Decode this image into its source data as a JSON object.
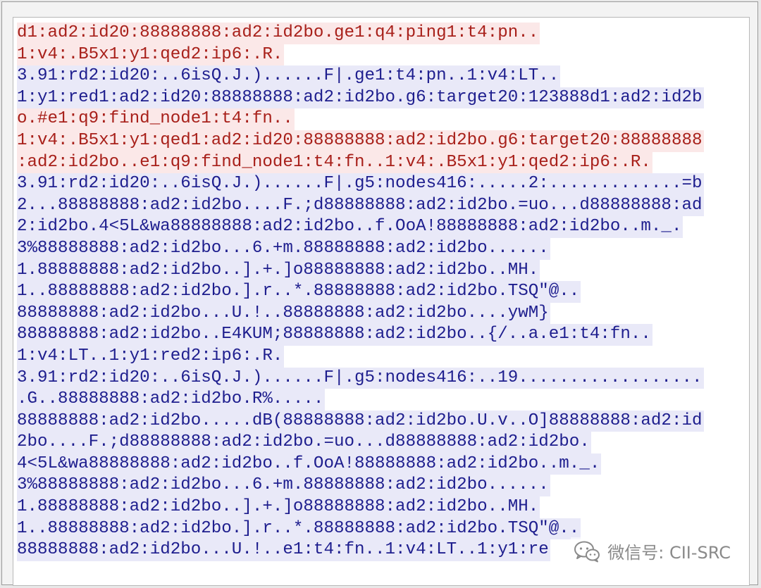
{
  "stream": {
    "lines": [
      {
        "dir": "client",
        "text": "d1:ad2:id20:88888888:ad2:id2bo.ge1:q4:ping1:t4:pn.."
      },
      {
        "dir": "client",
        "text": "1:v4:.B5x1:y1:qed2:ip6:.R."
      },
      {
        "dir": "server",
        "text": "3.91:rd2:id20:..6isQ.J.)......F|.ge1:t4:pn..1:v4:LT.."
      },
      {
        "dir": "server",
        "text": "1:y1:red1:ad2:id20:88888888:ad2:id2bo.g6:target20:123888d1:ad2:id2b"
      },
      {
        "dir": "client",
        "text": "o.#e1:q9:find_node1:t4:fn.."
      },
      {
        "dir": "client",
        "text": "1:v4:.B5x1:y1:qed1:ad2:id20:88888888:ad2:id2bo.g6:target20:88888888"
      },
      {
        "dir": "client",
        "text": ":ad2:id2bo..e1:q9:find_node1:t4:fn..1:v4:.B5x1:y1:qed2:ip6:.R."
      },
      {
        "dir": "server",
        "text": "3.91:rd2:id20:..6isQ.J.)......F|.g5:nodes416:.....2:.............=b"
      },
      {
        "dir": "server",
        "text": "2...88888888:ad2:id2bo....F.;d88888888:ad2:id2bo.=uo...d88888888:ad"
      },
      {
        "dir": "server",
        "text": "2:id2bo.4<5L&wa88888888:ad2:id2bo..f.OoA!88888888:ad2:id2bo..m._."
      },
      {
        "dir": "server",
        "text": "3%88888888:ad2:id2bo...6.+m.88888888:ad2:id2bo......"
      },
      {
        "dir": "server",
        "text": "1.88888888:ad2:id2bo..].+.]o88888888:ad2:id2bo..MH."
      },
      {
        "dir": "server",
        "text": "1..88888888:ad2:id2bo.].r..*.88888888:ad2:id2bo.TSQ\"@.."
      },
      {
        "dir": "server",
        "text": "88888888:ad2:id2bo...U.!..88888888:ad2:id2bo....ywM}"
      },
      {
        "dir": "server",
        "text": "88888888:ad2:id2bo..E4KUM;88888888:ad2:id2bo..{/..a.e1:t4:fn.."
      },
      {
        "dir": "server",
        "text": "1:v4:LT..1:y1:red2:ip6:.R."
      },
      {
        "dir": "server",
        "text": "3.91:rd2:id20:..6isQ.J.)......F|.g5:nodes416:..19.................."
      },
      {
        "dir": "server",
        "text": ".G..88888888:ad2:id2bo.R%....."
      },
      {
        "dir": "server",
        "text": "88888888:ad2:id2bo.....dB(88888888:ad2:id2bo.U.v..O]88888888:ad2:id"
      },
      {
        "dir": "server",
        "text": "2bo....F.;d88888888:ad2:id2bo.=uo...d88888888:ad2:id2bo."
      },
      {
        "dir": "server",
        "text": "4<5L&wa88888888:ad2:id2bo..f.OoA!88888888:ad2:id2bo..m._."
      },
      {
        "dir": "server",
        "text": "3%88888888:ad2:id2bo...6.+m.88888888:ad2:id2bo......"
      },
      {
        "dir": "server",
        "text": "1.88888888:ad2:id2bo..].+.]o88888888:ad2:id2bo..MH."
      },
      {
        "dir": "server",
        "text": "1..88888888:ad2:id2bo.].r..*.88888888:ad2:id2bo.TSQ\"@.."
      },
      {
        "dir": "server",
        "text": "88888888:ad2:id2bo...U.!..e1:t4:fn..1:v4:LT..1:y1:re"
      }
    ]
  },
  "watermark": {
    "text": "微信号: CII-SRC",
    "icon": "wechat-logo-icon"
  },
  "colors": {
    "client_text": "#a8201a",
    "client_bg": "#fbe8e8",
    "server_text": "#1e1e8e",
    "server_bg": "#e9e9f8"
  }
}
